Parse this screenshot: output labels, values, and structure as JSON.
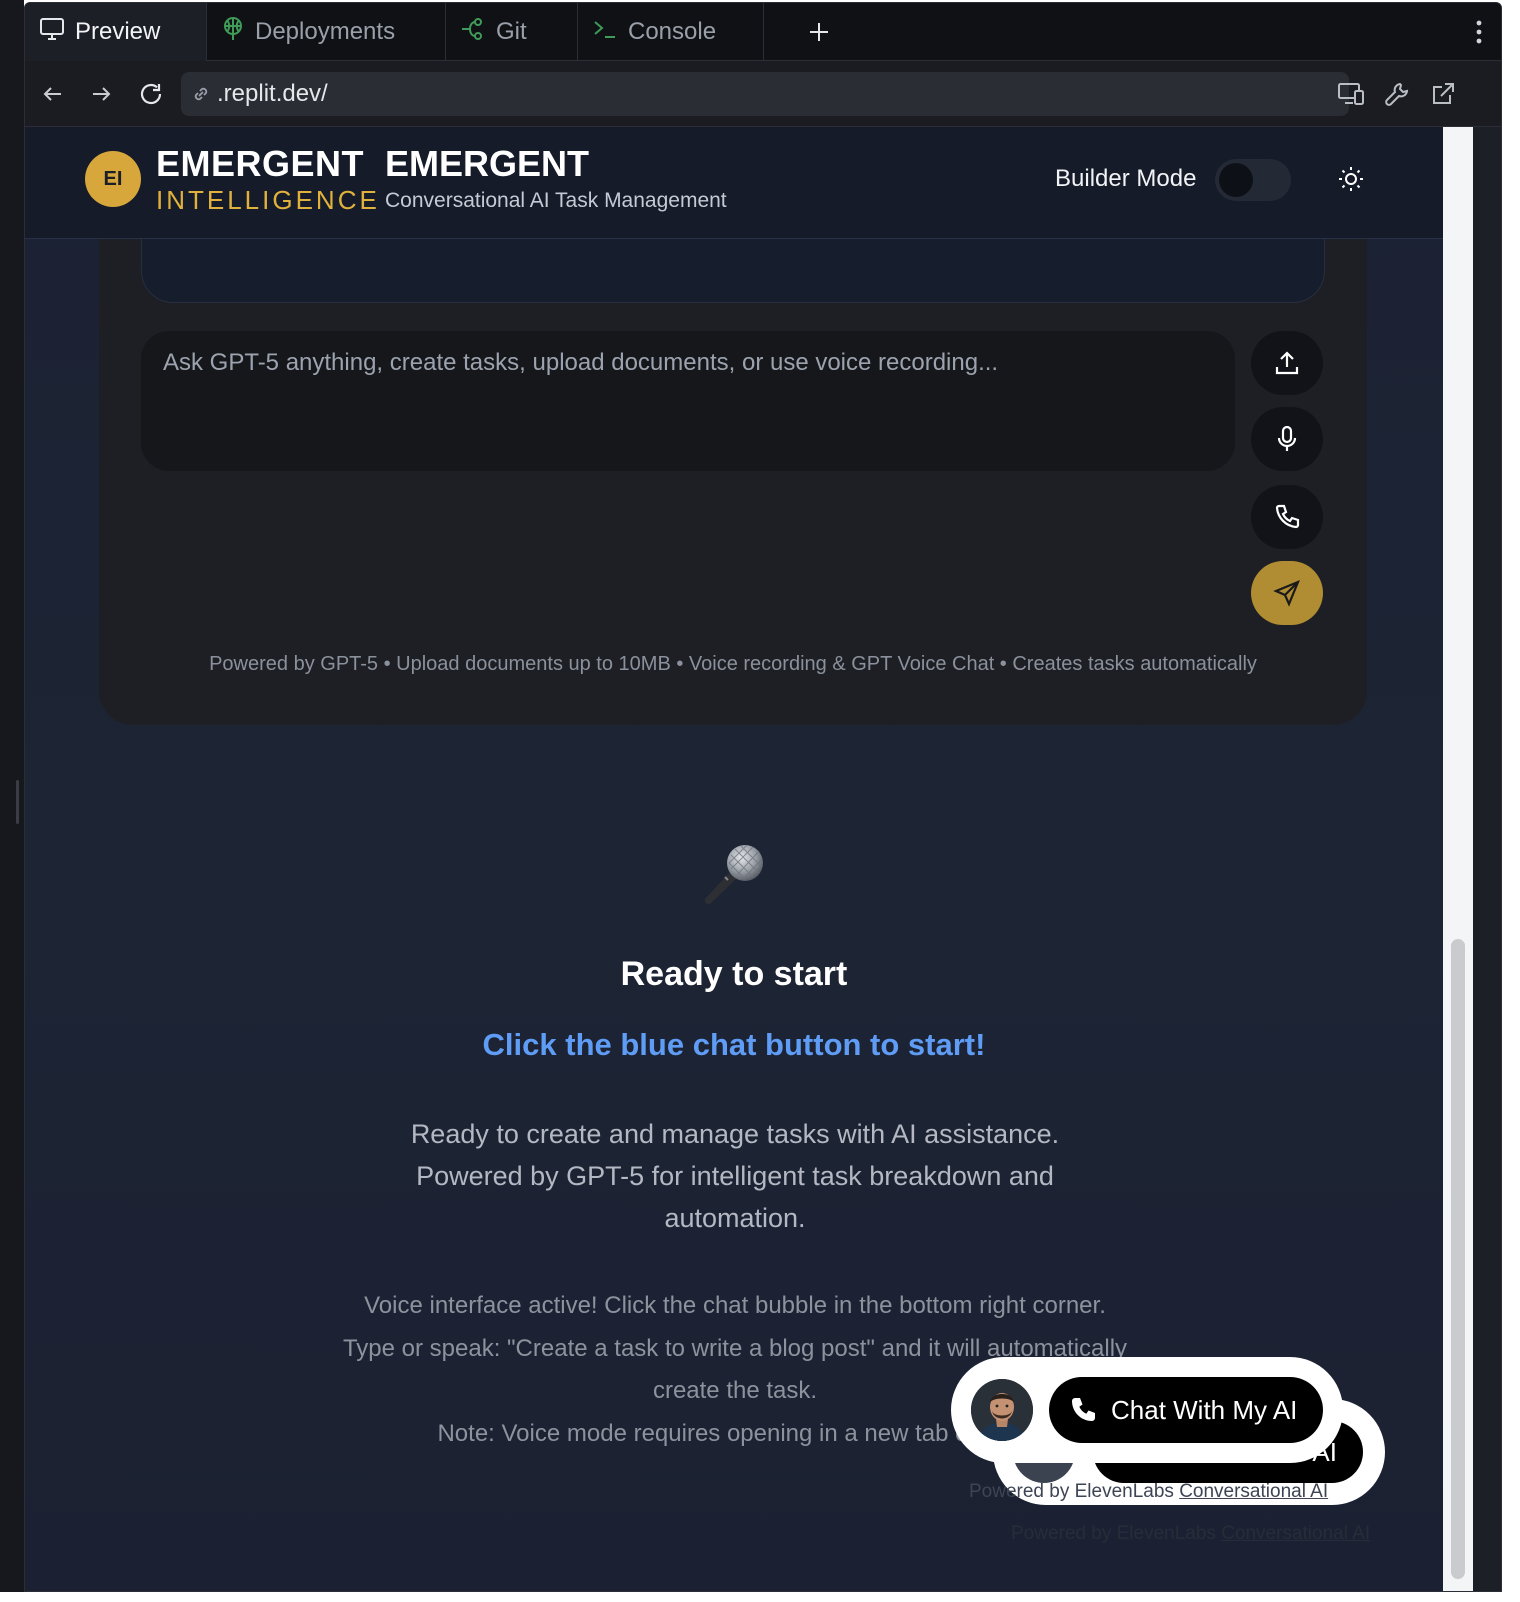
{
  "tabs": [
    {
      "label": "Preview",
      "icon": "monitor-icon",
      "active": true
    },
    {
      "label": "Deployments",
      "icon": "deployments-icon",
      "active": false
    },
    {
      "label": "Git",
      "icon": "git-branch-icon",
      "active": false
    },
    {
      "label": "Console",
      "icon": "terminal-icon",
      "active": false
    }
  ],
  "address_bar": {
    "url": ".replit.dev/"
  },
  "header": {
    "logo_initials": "EI",
    "brand_line1": "EMERGENT",
    "brand_line2": "INTELLIGENCE",
    "title": "EMERGENT",
    "subtitle": "Conversational AI Task Management",
    "builder_mode_label": "Builder Mode",
    "builder_mode_on": false
  },
  "chat": {
    "input_placeholder": "Ask GPT-5 anything, create tasks, upload documents, or use voice recording...",
    "footnote": "Powered by GPT-5 • Upload documents up to 10MB • Voice recording & GPT Voice Chat • Creates tasks automatically"
  },
  "empty_state": {
    "emoji": "🎤",
    "title": "Ready to start",
    "cta": "Click the blue chat button to start!",
    "description": "Ready to create and manage tasks with AI assistance. Powered by GPT-5 for intelligent task breakdown and automation.",
    "note_1": "Voice interface active! Click the chat bubble in the bottom right corner.",
    "note_2": "Type or speak: \"Create a task to write a blog post\" and it will automatically create the task.",
    "note_3": "Note: Voice mode requires opening in a new tab outside"
  },
  "voice_widget": {
    "button_label": "Chat With My AI",
    "credit_prefix": "Powered by ElevenLabs ",
    "credit_link": "Conversational AI",
    "ghost_button_label": "AI"
  },
  "colors": {
    "accent_gold": "#d7a73b",
    "send_button": "#b08c32",
    "cta_blue": "#5f9cf5",
    "app_background": "#1c2333"
  }
}
